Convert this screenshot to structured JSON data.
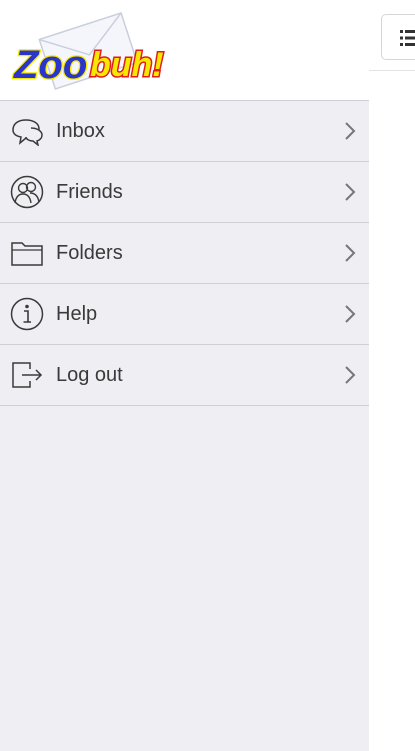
{
  "brand": {
    "logo_text": "zoobuh!"
  },
  "menu": {
    "items": [
      {
        "label": "Inbox",
        "icon": "chat-bubble-icon"
      },
      {
        "label": "Friends",
        "icon": "friends-icon"
      },
      {
        "label": "Folders",
        "icon": "folder-icon"
      },
      {
        "label": "Help",
        "icon": "info-icon"
      },
      {
        "label": "Log out",
        "icon": "logout-icon"
      }
    ]
  },
  "toolbar": {
    "menu_button_icon": "list-icon"
  },
  "colors": {
    "drawer_bg": "#efeef3",
    "divider": "#cfced4",
    "logo_blue": "#2b35c9",
    "logo_yellow": "#f7e800",
    "logo_red": "#e21b1b"
  }
}
